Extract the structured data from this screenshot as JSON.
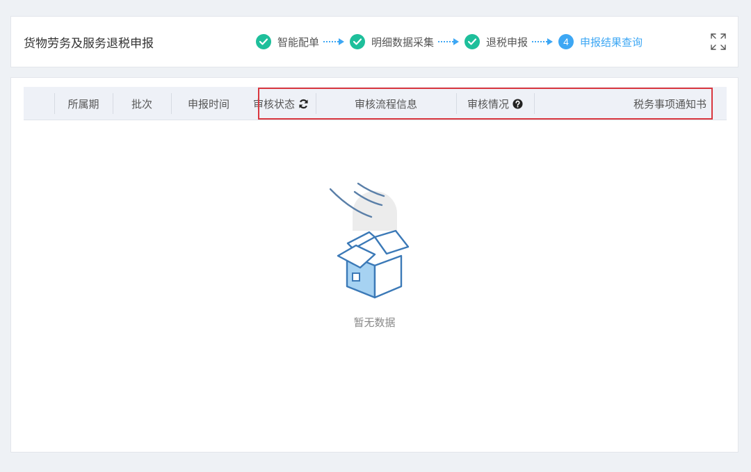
{
  "header": {
    "title": "货物劳务及服务退税申报",
    "steps": [
      {
        "label": "智能配单",
        "state": "done"
      },
      {
        "label": "明细数据采集",
        "state": "done"
      },
      {
        "label": "退税申报",
        "state": "done"
      },
      {
        "number": "4",
        "label": "申报结果查询",
        "state": "active"
      }
    ],
    "expand_icon": "expand-icon"
  },
  "table": {
    "columns": [
      {
        "label": "所属期"
      },
      {
        "label": "批次"
      },
      {
        "label": "申报时间"
      },
      {
        "label": "审核状态",
        "icon": "refresh-icon"
      },
      {
        "label": "审核流程信息"
      },
      {
        "label": "审核情况",
        "icon": "help-circle-icon"
      },
      {
        "label": "税务事项通知书"
      }
    ],
    "rows": []
  },
  "empty_state": {
    "text": "暂无数据",
    "icon": "empty-box-icon"
  },
  "colors": {
    "step_done": "#1ebf9b",
    "step_active": "#3da7f4",
    "highlight": "#d9363e",
    "header_bg": "#eef1f7"
  }
}
